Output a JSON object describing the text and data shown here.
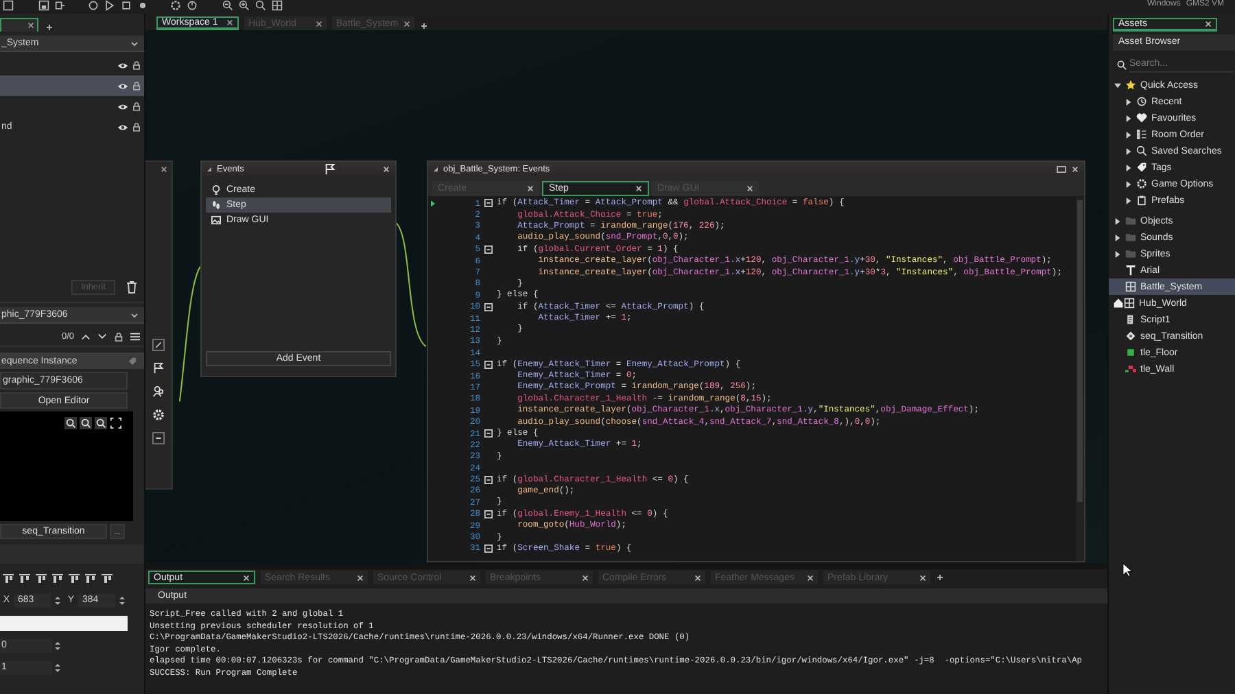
{
  "status": [
    "Windows",
    "GMS2 VM"
  ],
  "left_panel": {
    "layer_dropdown": "_System",
    "layers": [
      {
        "selected": false
      },
      {
        "selected": true
      },
      {
        "selected": false
      },
      {
        "label": "nd",
        "selected": false
      }
    ],
    "inherit_button": {
      "label": "Inherit",
      "disabled": true
    },
    "sequence_dropdown": "phic_779F3606",
    "counter": "0/0",
    "instance_header": "equence Instance",
    "sequence_field": "graphic_779F3606",
    "open_editor": "Open Editor",
    "sequence_button": "seq_Transition",
    "more_button": "...",
    "x_label": "X",
    "x_value": "683",
    "y_label": "Y",
    "y_value": "384",
    "field_3": "0",
    "field_4": "1"
  },
  "workspace_tabs": [
    {
      "label": "Workspace 1",
      "selected": true
    },
    {
      "label": "Hub_World",
      "selected": false
    },
    {
      "label": "Battle_System",
      "selected": false
    }
  ],
  "events_window": {
    "title": "Events",
    "events": [
      {
        "label": "Create",
        "kind": "create",
        "selected": false
      },
      {
        "label": "Step",
        "kind": "step",
        "selected": true
      },
      {
        "label": "Draw GUI",
        "kind": "draw",
        "selected": false
      }
    ],
    "add_button": "Add Event"
  },
  "code_window": {
    "title": "obj_Battle_System: Events",
    "tabs": [
      {
        "label": "Create",
        "selected": false
      },
      {
        "label": "Step",
        "selected": true
      },
      {
        "label": "Draw GUI",
        "selected": false
      }
    ],
    "lines": [
      {
        "n": "1",
        "fold": true,
        "code": [
          {
            "kind": "keyword",
            "text": "if ("
          },
          {
            "kind": "variable",
            "text": "Attack_Timer"
          },
          {
            "kind": "keyword",
            "text": " = "
          },
          {
            "kind": "variable",
            "text": "Attack_Prompt"
          },
          {
            "kind": "keyword",
            "text": " && "
          },
          {
            "kind": "global",
            "text": "global.Attack_Choice"
          },
          {
            "kind": "keyword",
            "text": " = "
          },
          {
            "kind": "constant",
            "text": "false"
          },
          {
            "kind": "keyword",
            "text": ") {"
          }
        ]
      },
      {
        "n": "2",
        "fold": false,
        "code": [
          {
            "kind": "global",
            "text": "    global.Attack_Choice"
          },
          {
            "kind": "keyword",
            "text": " = "
          },
          {
            "kind": "constant",
            "text": "true"
          },
          {
            "kind": "keyword",
            "text": ";"
          }
        ]
      },
      {
        "n": "3",
        "fold": false,
        "code": [
          {
            "kind": "variable",
            "text": "    Attack_Prompt"
          },
          {
            "kind": "keyword",
            "text": " = "
          },
          {
            "kind": "function",
            "text": "irandom_range"
          },
          {
            "kind": "keyword",
            "text": "("
          },
          {
            "kind": "number",
            "text": "176"
          },
          {
            "kind": "keyword",
            "text": ", "
          },
          {
            "kind": "number",
            "text": "226"
          },
          {
            "kind": "keyword",
            "text": ");"
          }
        ]
      },
      {
        "n": "4",
        "fold": false,
        "code": [
          {
            "kind": "function",
            "text": "    audio_play_sound"
          },
          {
            "kind": "keyword",
            "text": "("
          },
          {
            "kind": "asset",
            "text": "snd_Prompt"
          },
          {
            "kind": "keyword",
            "text": ","
          },
          {
            "kind": "number",
            "text": "0"
          },
          {
            "kind": "keyword",
            "text": ","
          },
          {
            "kind": "number",
            "text": "0"
          },
          {
            "kind": "keyword",
            "text": ");"
          }
        ]
      },
      {
        "n": "5",
        "fold": true,
        "code": [
          {
            "kind": "keyword",
            "text": "    if ("
          },
          {
            "kind": "global",
            "text": "global.Current_Order"
          },
          {
            "kind": "keyword",
            "text": " = "
          },
          {
            "kind": "number",
            "text": "1"
          },
          {
            "kind": "keyword",
            "text": ") {"
          }
        ]
      },
      {
        "n": "6",
        "fold": false,
        "code": [
          {
            "kind": "function",
            "text": "        instance_create_layer"
          },
          {
            "kind": "keyword",
            "text": "("
          },
          {
            "kind": "asset",
            "text": "obj_Character_1"
          },
          {
            "kind": "variable",
            "text": ".x"
          },
          {
            "kind": "keyword",
            "text": "+"
          },
          {
            "kind": "number",
            "text": "120"
          },
          {
            "kind": "keyword",
            "text": ", "
          },
          {
            "kind": "asset",
            "text": "obj_Character_1"
          },
          {
            "kind": "variable",
            "text": ".y"
          },
          {
            "kind": "keyword",
            "text": "+"
          },
          {
            "kind": "number",
            "text": "30"
          },
          {
            "kind": "keyword",
            "text": ", "
          },
          {
            "kind": "string",
            "text": "\"Instances\""
          },
          {
            "kind": "keyword",
            "text": ", "
          },
          {
            "kind": "asset",
            "text": "obj_Battle_Prompt"
          },
          {
            "kind": "keyword",
            "text": ");"
          }
        ]
      },
      {
        "n": "7",
        "fold": false,
        "code": [
          {
            "kind": "function",
            "text": "        instance_create_layer"
          },
          {
            "kind": "keyword",
            "text": "("
          },
          {
            "kind": "asset",
            "text": "obj_Character_1"
          },
          {
            "kind": "variable",
            "text": ".x"
          },
          {
            "kind": "keyword",
            "text": "+"
          },
          {
            "kind": "number",
            "text": "120"
          },
          {
            "kind": "keyword",
            "text": ", "
          },
          {
            "kind": "asset",
            "text": "obj_Character_1"
          },
          {
            "kind": "variable",
            "text": ".y"
          },
          {
            "kind": "keyword",
            "text": "+"
          },
          {
            "kind": "number",
            "text": "30"
          },
          {
            "kind": "keyword",
            "text": "*"
          },
          {
            "kind": "number",
            "text": "3"
          },
          {
            "kind": "keyword",
            "text": ", "
          },
          {
            "kind": "string",
            "text": "\"Instances\""
          },
          {
            "kind": "keyword",
            "text": ", "
          },
          {
            "kind": "asset",
            "text": "obj_Battle_Prompt"
          },
          {
            "kind": "keyword",
            "text": ");"
          }
        ]
      },
      {
        "n": "8",
        "fold": false,
        "code": [
          {
            "kind": "keyword",
            "text": "    }"
          }
        ]
      },
      {
        "n": "9",
        "fold": false,
        "code": [
          {
            "kind": "keyword",
            "text": "} else {"
          }
        ]
      },
      {
        "n": "10",
        "fold": true,
        "code": [
          {
            "kind": "keyword",
            "text": "    if ("
          },
          {
            "kind": "variable",
            "text": "Attack_Timer"
          },
          {
            "kind": "keyword",
            "text": " <= "
          },
          {
            "kind": "variable",
            "text": "Attack_Prompt"
          },
          {
            "kind": "keyword",
            "text": ") {"
          }
        ]
      },
      {
        "n": "11",
        "fold": false,
        "code": [
          {
            "kind": "variable",
            "text": "        Attack_Timer"
          },
          {
            "kind": "keyword",
            "text": " += "
          },
          {
            "kind": "number",
            "text": "1"
          },
          {
            "kind": "keyword",
            "text": ";"
          }
        ]
      },
      {
        "n": "12",
        "fold": false,
        "code": [
          {
            "kind": "keyword",
            "text": "    }"
          }
        ]
      },
      {
        "n": "13",
        "fold": false,
        "code": [
          {
            "kind": "keyword",
            "text": "}"
          }
        ]
      },
      {
        "n": "14",
        "fold": false
      },
      {
        "n": "15",
        "fold": true,
        "code": [
          {
            "kind": "keyword",
            "text": "if ("
          },
          {
            "kind": "variable",
            "text": "Enemy_Attack_Timer"
          },
          {
            "kind": "keyword",
            "text": " = "
          },
          {
            "kind": "variable",
            "text": "Enemy_Attack_Prompt"
          },
          {
            "kind": "keyword",
            "text": ") {"
          }
        ]
      },
      {
        "n": "16",
        "fold": false,
        "code": [
          {
            "kind": "variable",
            "text": "    Enemy_Attack_Timer"
          },
          {
            "kind": "keyword",
            "text": " = "
          },
          {
            "kind": "number",
            "text": "0"
          },
          {
            "kind": "keyword",
            "text": ";"
          }
        ]
      },
      {
        "n": "17",
        "fold": false,
        "code": [
          {
            "kind": "variable",
            "text": "    Enemy_Attack_Prompt"
          },
          {
            "kind": "keyword",
            "text": " = "
          },
          {
            "kind": "function",
            "text": "irandom_range"
          },
          {
            "kind": "keyword",
            "text": "("
          },
          {
            "kind": "number",
            "text": "189"
          },
          {
            "kind": "keyword",
            "text": ", "
          },
          {
            "kind": "number",
            "text": "256"
          },
          {
            "kind": "keyword",
            "text": ");"
          }
        ]
      },
      {
        "n": "18",
        "fold": false,
        "code": [
          {
            "kind": "global",
            "text": "    global.Character_1_Health"
          },
          {
            "kind": "keyword",
            "text": " -= "
          },
          {
            "kind": "function",
            "text": "irandom_range"
          },
          {
            "kind": "keyword",
            "text": "("
          },
          {
            "kind": "number",
            "text": "8"
          },
          {
            "kind": "keyword",
            "text": ","
          },
          {
            "kind": "number",
            "text": "15"
          },
          {
            "kind": "keyword",
            "text": ");"
          }
        ]
      },
      {
        "n": "19",
        "fold": false,
        "code": [
          {
            "kind": "function",
            "text": "    instance_create_layer"
          },
          {
            "kind": "keyword",
            "text": "("
          },
          {
            "kind": "asset",
            "text": "obj_Character_1"
          },
          {
            "kind": "variable",
            "text": ".x"
          },
          {
            "kind": "keyword",
            "text": ","
          },
          {
            "kind": "asset",
            "text": "obj_Character_1"
          },
          {
            "kind": "variable",
            "text": ".y"
          },
          {
            "kind": "keyword",
            "text": ","
          },
          {
            "kind": "string",
            "text": "\"Instances\""
          },
          {
            "kind": "keyword",
            "text": ","
          },
          {
            "kind": "asset",
            "text": "obj_Damage_Effect"
          },
          {
            "kind": "keyword",
            "text": ");"
          }
        ]
      },
      {
        "n": "20",
        "fold": false,
        "code": [
          {
            "kind": "function",
            "text": "    audio_play_sound"
          },
          {
            "kind": "keyword",
            "text": "("
          },
          {
            "kind": "function",
            "text": "choose"
          },
          {
            "kind": "keyword",
            "text": "("
          },
          {
            "kind": "asset",
            "text": "snd_Attack_4"
          },
          {
            "kind": "keyword",
            "text": ","
          },
          {
            "kind": "asset",
            "text": "snd_Attack_7"
          },
          {
            "kind": "keyword",
            "text": ","
          },
          {
            "kind": "asset",
            "text": "snd_Attack_8"
          },
          {
            "kind": "keyword",
            "text": ",),"
          },
          {
            "kind": "number",
            "text": "0"
          },
          {
            "kind": "keyword",
            "text": ","
          },
          {
            "kind": "number",
            "text": "0"
          },
          {
            "kind": "keyword",
            "text": ");"
          }
        ]
      },
      {
        "n": "21",
        "fold": true,
        "code": [
          {
            "kind": "keyword",
            "text": "} else {"
          }
        ]
      },
      {
        "n": "22",
        "fold": false,
        "code": [
          {
            "kind": "variable",
            "text": "    Enemy_Attack_Timer"
          },
          {
            "kind": "keyword",
            "text": " += "
          },
          {
            "kind": "number",
            "text": "1"
          },
          {
            "kind": "keyword",
            "text": ";"
          }
        ]
      },
      {
        "n": "23",
        "fold": false,
        "code": [
          {
            "kind": "keyword",
            "text": "}"
          }
        ]
      },
      {
        "n": "24",
        "fold": false
      },
      {
        "n": "25",
        "fold": true,
        "code": [
          {
            "kind": "keyword",
            "text": "if ("
          },
          {
            "kind": "global",
            "text": "global.Character_1_Health"
          },
          {
            "kind": "keyword",
            "text": " <= "
          },
          {
            "kind": "number",
            "text": "0"
          },
          {
            "kind": "keyword",
            "text": ") {"
          }
        ]
      },
      {
        "n": "26",
        "fold": false,
        "code": [
          {
            "kind": "function",
            "text": "    game_end"
          },
          {
            "kind": "keyword",
            "text": "();"
          }
        ]
      },
      {
        "n": "27",
        "fold": false,
        "code": [
          {
            "kind": "keyword",
            "text": "}"
          }
        ]
      },
      {
        "n": "28",
        "fold": true,
        "code": [
          {
            "kind": "keyword",
            "text": "if ("
          },
          {
            "kind": "global",
            "text": "global.Enemy_1_Health"
          },
          {
            "kind": "keyword",
            "text": " <= "
          },
          {
            "kind": "number",
            "text": "0"
          },
          {
            "kind": "keyword",
            "text": ") {"
          }
        ]
      },
      {
        "n": "29",
        "fold": false,
        "code": [
          {
            "kind": "function",
            "text": "    room_goto"
          },
          {
            "kind": "keyword",
            "text": "("
          },
          {
            "kind": "asset",
            "text": "Hub_World"
          },
          {
            "kind": "keyword",
            "text": ");"
          }
        ]
      },
      {
        "n": "30",
        "fold": false,
        "code": [
          {
            "kind": "keyword",
            "text": "}"
          }
        ]
      },
      {
        "n": "31",
        "fold": true,
        "code": [
          {
            "kind": "keyword",
            "text": "if ("
          },
          {
            "kind": "variable",
            "text": "Screen_Shake"
          },
          {
            "kind": "keyword",
            "text": " = "
          },
          {
            "kind": "constant",
            "text": "true"
          },
          {
            "kind": "keyword",
            "text": ") {"
          }
        ]
      }
    ]
  },
  "output_panel": {
    "tabs": [
      {
        "label": "Output",
        "selected": true
      },
      {
        "label": "Search Results",
        "selected": false
      },
      {
        "label": "Source Control",
        "selected": false
      },
      {
        "label": "Breakpoints",
        "selected": false
      },
      {
        "label": "Compile Errors",
        "selected": false
      },
      {
        "label": "Feather Messages",
        "selected": false
      },
      {
        "label": "Prefab Library",
        "selected": false
      }
    ],
    "header": "Output",
    "lines": [
      "Script_Free called with 2 and global 1",
      "Unsetting previous scheduler resolution of 1",
      "C:\\ProgramData/GameMakerStudio2-LTS2026/Cache/runtimes\\runtime-2026.0.0.23/windows/x64/Runner.exe DONE (0)",
      "Igor complete.",
      "elapsed time 00:00:07.1206323s for command \"C:\\ProgramData/GameMakerStudio2-LTS2026/Cache/runtimes\\runtime-2026.0.0.23/bin/igor/windows/x64/Igor.exe\" -j=8  -options=\"C:\\Users\\nitra\\Ap",
      "SUCCESS: Run Program Complete"
    ]
  },
  "asset_browser": {
    "tab": "Assets",
    "title": "Asset Browser",
    "search_placeholder": "Search...",
    "items": [
      {
        "label": "Quick Access",
        "kind": "star",
        "expanded": true,
        "selected": false,
        "children": [
          {
            "label": "Recent",
            "kind": "recent",
            "expanded": false
          },
          {
            "label": "Favourites",
            "kind": "heart",
            "expanded": false
          },
          {
            "label": "Room Order",
            "kind": "order",
            "expanded": false
          },
          {
            "label": "Saved Searches",
            "kind": "search",
            "expanded": false
          },
          {
            "label": "Tags",
            "kind": "tag",
            "expanded": false
          },
          {
            "label": "Game Options",
            "kind": "gear",
            "expanded": false
          },
          {
            "label": "Prefabs",
            "kind": "prefab",
            "expanded": false
          }
        ]
      },
      {
        "label": "Objects",
        "kind": "folder",
        "expanded": false,
        "selected": false
      },
      {
        "label": "Sounds",
        "kind": "folder",
        "expanded": false,
        "selected": false
      },
      {
        "label": "Sprites",
        "kind": "folder",
        "expanded": false,
        "selected": false
      },
      {
        "label": "Arial",
        "kind": "font",
        "selected": false
      },
      {
        "label": "Battle_System",
        "kind": "room",
        "selected": true
      },
      {
        "label": "Hub_World",
        "kind": "home_room",
        "selected": false
      },
      {
        "label": "Script1",
        "kind": "script",
        "selected": false
      },
      {
        "label": "seq_Transition",
        "kind": "sequence",
        "selected": false
      },
      {
        "label": "tle_Floor",
        "kind": "tile_floor",
        "selected": false
      },
      {
        "label": "tle_Wall",
        "kind": "tile_wall",
        "selected": false
      }
    ]
  }
}
